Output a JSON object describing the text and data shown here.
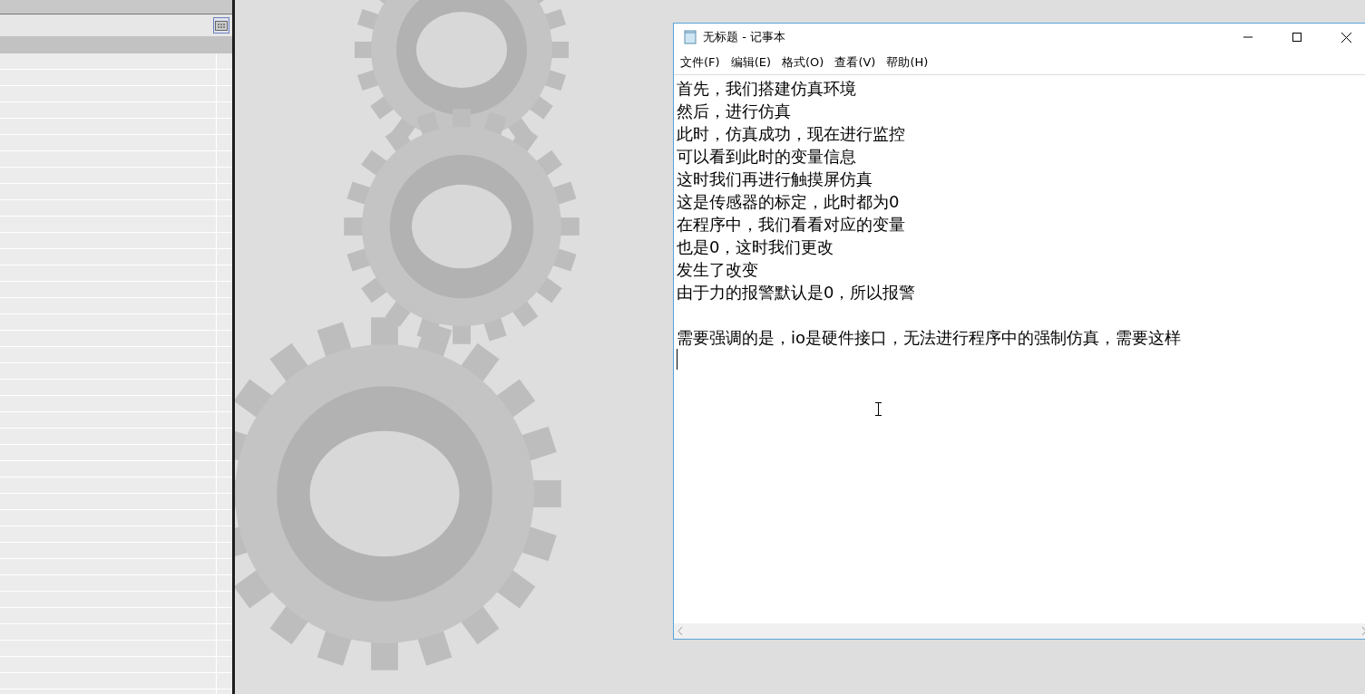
{
  "notepad": {
    "title": "无标题 - 记事本",
    "menu": [
      "文件(F)",
      "编辑(E)",
      "格式(O)",
      "查看(V)",
      "帮助(H)"
    ],
    "paragraphs": [
      [
        "首先，我们搭建仿真环境",
        "然后，进行仿真",
        "此时，仿真成功，现在进行监控",
        "可以看到此时的变量信息",
        "这时我们再进行触摸屏仿真",
        "这是传感器的标定，此时都为0",
        "在程序中，我们看看对应的变量",
        "也是0，这时我们更改",
        "发生了改变",
        "由于力的报警默认是0，所以报警"
      ],
      [
        "需要强调的是，io是硬件接口，无法进行程序中的强制仿真，需要这样"
      ]
    ]
  }
}
